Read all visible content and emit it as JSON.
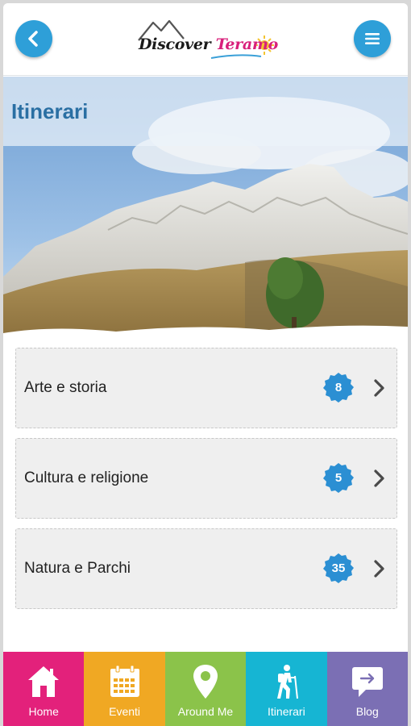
{
  "header": {
    "logo_word1": "Discover",
    "logo_word2": "Teramo",
    "back_icon": "chevron-left-icon",
    "menu_icon": "hamburger-menu-icon"
  },
  "page": {
    "title": "Itinerari"
  },
  "categories": [
    {
      "label": "Arte e storia",
      "count": "8"
    },
    {
      "label": "Cultura e religione",
      "count": "5"
    },
    {
      "label": "Natura e Parchi",
      "count": "35"
    }
  ],
  "bottom_nav": [
    {
      "label": "Home",
      "icon": "home-icon",
      "color": "#e3217b"
    },
    {
      "label": "Eventi",
      "icon": "calendar-icon",
      "color": "#f0a823"
    },
    {
      "label": "Around Me",
      "icon": "map-pin-icon",
      "color": "#8bc34a"
    },
    {
      "label": "Itinerari",
      "icon": "hiker-icon",
      "color": "#16b5d3"
    },
    {
      "label": "Blog",
      "icon": "chat-bubble-icon",
      "color": "#7b6fb4"
    }
  ],
  "colors": {
    "accent_blue": "#2e9fd8",
    "title_blue": "#2a6fa3",
    "badge_blue": "#2b8fd3"
  }
}
